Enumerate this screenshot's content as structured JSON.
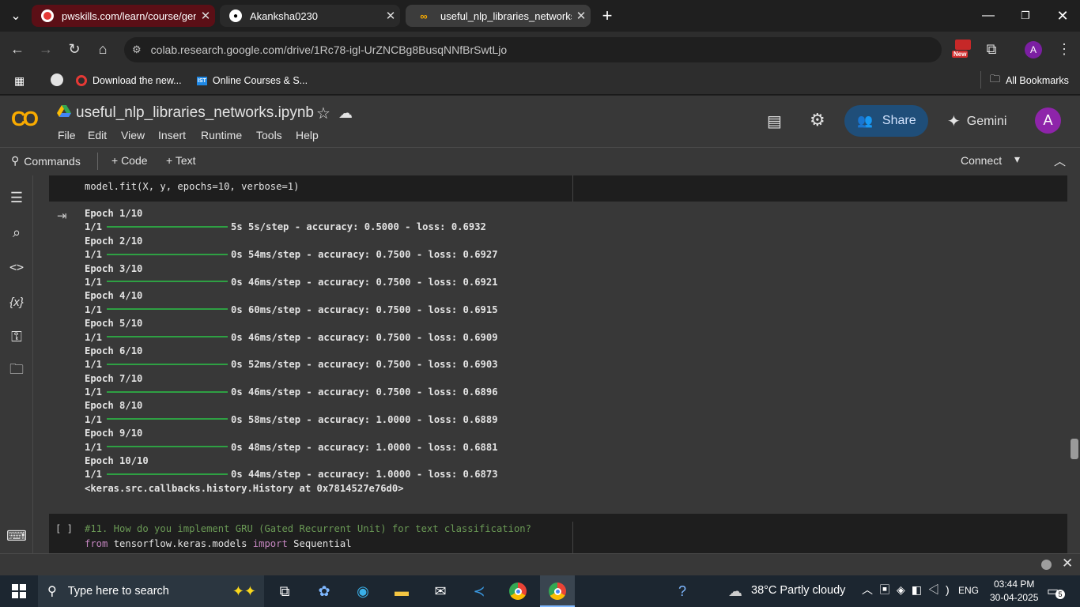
{
  "browser": {
    "tabs": [
      {
        "title": "pwskills.com/learn/course/gena",
        "icon": "pwskills-icon",
        "active": false
      },
      {
        "title": "Akanksha0230",
        "icon": "github-icon",
        "active": false
      },
      {
        "title": "useful_nlp_libraries_networks.ip",
        "icon": "colab-icon",
        "active": true
      }
    ],
    "new_tab_symbol": "+",
    "url": "colab.research.google.com/drive/1Rc78-igl-UrZNCBg8BusqNNfBrSwtLjo",
    "profile_initial": "A",
    "new_badge": "New",
    "bookmarks": [
      {
        "label": "Download the new...",
        "icon": "opera-icon"
      },
      {
        "label": "Online Courses & S...",
        "icon": "ist-icon"
      }
    ],
    "all_bookmarks": "All Bookmarks"
  },
  "colab": {
    "logo": "CO",
    "notebook_title": "useful_nlp_libraries_networks.ipynb",
    "menu": [
      "File",
      "Edit",
      "View",
      "Insert",
      "Runtime",
      "Tools",
      "Help"
    ],
    "share_label": "Share",
    "gemini_label": "Gemini",
    "avatar_initial": "A",
    "toolbar": {
      "commands": "Commands",
      "code": "+ Code",
      "text": "+ Text",
      "connect": "Connect"
    },
    "accent": "#1f4e79",
    "logo_color": "#f9ab00"
  },
  "cells": {
    "prev_code": "model.fit(X, y, epochs=10, verbose=1)",
    "output": [
      "Epoch 1/10",
      {
        "step": "1/1",
        "metrics": "5s 5s/step - accuracy: 0.5000 - loss: 0.6932"
      },
      "Epoch 2/10",
      {
        "step": "1/1",
        "metrics": "0s 54ms/step - accuracy: 0.7500 - loss: 0.6927"
      },
      "Epoch 3/10",
      {
        "step": "1/1",
        "metrics": "0s 46ms/step - accuracy: 0.7500 - loss: 0.6921"
      },
      "Epoch 4/10",
      {
        "step": "1/1",
        "metrics": "0s 60ms/step - accuracy: 0.7500 - loss: 0.6915"
      },
      "Epoch 5/10",
      {
        "step": "1/1",
        "metrics": "0s 46ms/step - accuracy: 0.7500 - loss: 0.6909"
      },
      "Epoch 6/10",
      {
        "step": "1/1",
        "metrics": "0s 52ms/step - accuracy: 0.7500 - loss: 0.6903"
      },
      "Epoch 7/10",
      {
        "step": "1/1",
        "metrics": "0s 46ms/step - accuracy: 0.7500 - loss: 0.6896"
      },
      "Epoch 8/10",
      {
        "step": "1/1",
        "metrics": "0s 58ms/step - accuracy: 1.0000 - loss: 0.6889"
      },
      "Epoch 9/10",
      {
        "step": "1/1",
        "metrics": "0s 48ms/step - accuracy: 1.0000 - loss: 0.6881"
      },
      "Epoch 10/10",
      {
        "step": "1/1",
        "metrics": "0s 44ms/step - accuracy: 1.0000 - loss: 0.6873"
      },
      "<keras.src.callbacks.history.History at 0x7814527e76d0>"
    ],
    "next_cell": {
      "run_indicator": "[ ]",
      "comment": "#11. How do you implement GRU (Gated Recurrent Unit) for text classification?",
      "line2": {
        "kw_from": "from",
        "module": " tensorflow.keras.models ",
        "kw_import": "import",
        "name": " Sequential"
      }
    }
  },
  "taskbar": {
    "search_placeholder": "Type here to search",
    "weather": "38°C  Partly cloudy",
    "language": "ENG",
    "time": "03:44 PM",
    "date": "30-04-2025",
    "notification_count": "5"
  }
}
